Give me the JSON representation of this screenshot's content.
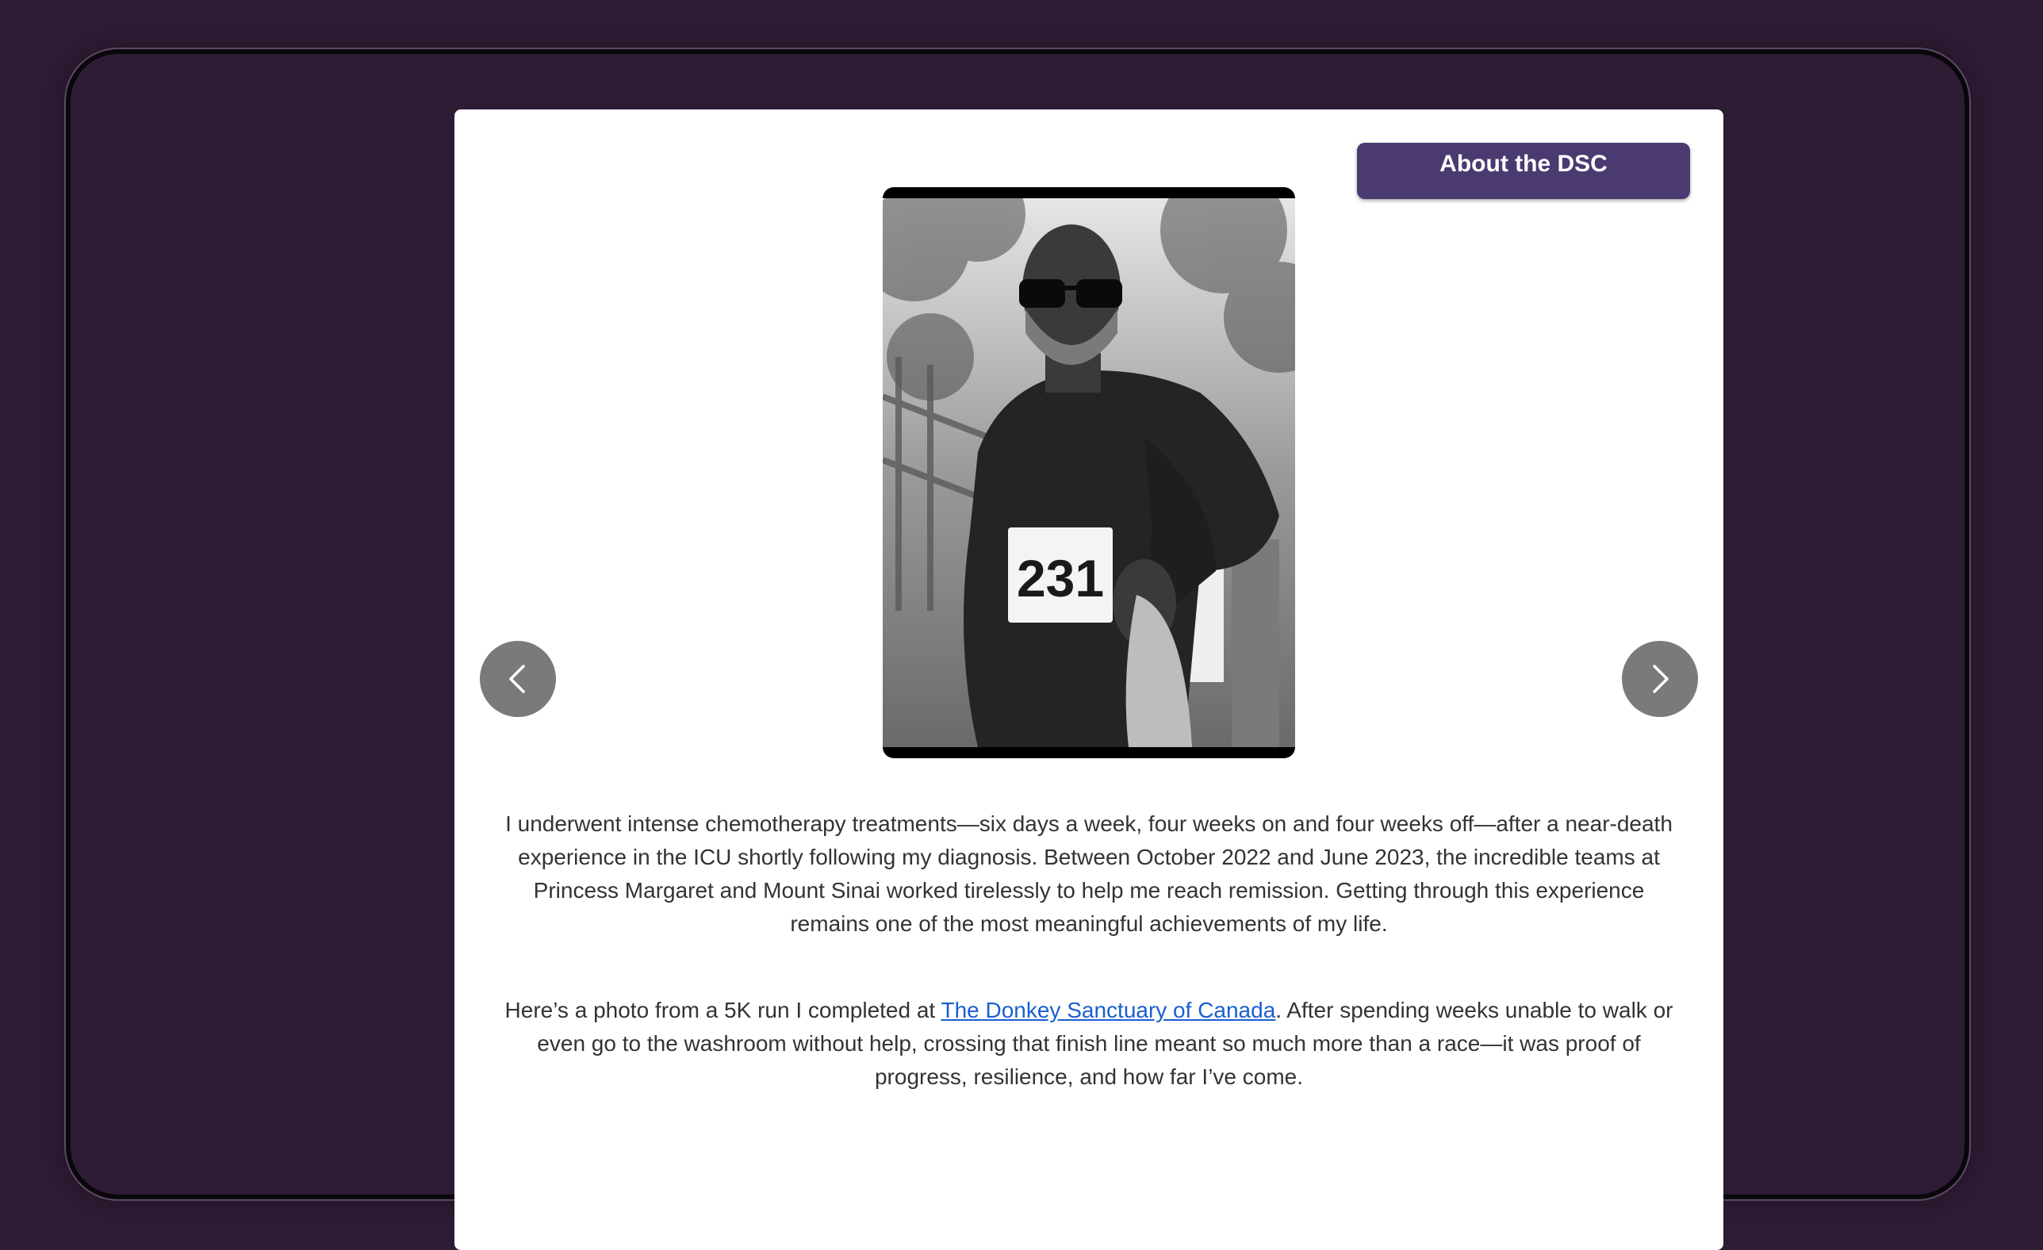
{
  "header": {
    "about_label": "About the DSC"
  },
  "carousel": {
    "prev_icon": "chevron-left-icon",
    "next_icon": "chevron-right-icon",
    "bib_number": "231"
  },
  "content": {
    "paragraph1": "I underwent intense chemotherapy treatments—six days a week, four weeks on and four weeks off—after a near-death experience in the ICU shortly following my diagnosis. Between October 2022 and June 2023, the incredible teams at Princess Margaret and Mount Sinai worked tirelessly to help me reach remission. Getting through this experience remains one of the most meaningful achievements of my life.",
    "paragraph2_before": "Here’s a photo from a 5K run I completed at ",
    "paragraph2_link": "The Donkey Sanctuary of Canada",
    "paragraph2_after": ". After spending weeks unable to walk or even go to the washroom without help, crossing that finish line meant so much more than a race—it was proof of progress, resilience, and how far I’ve come."
  },
  "colors": {
    "background": "#2e1b34",
    "card": "#ffffff",
    "button": "#4a3a70",
    "link": "#1a5fd0",
    "nav_button": "#7a7a7a"
  }
}
